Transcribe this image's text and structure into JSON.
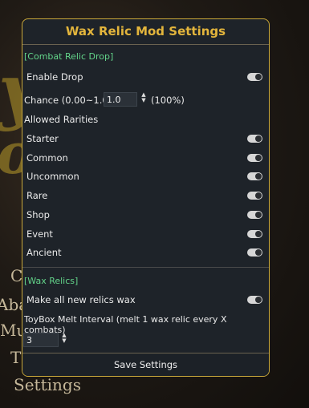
{
  "background": {
    "menu_items": [
      "C",
      "Aba",
      "Mu",
      "T",
      "Settings"
    ]
  },
  "panel": {
    "title": "Wax Relic Mod Settings",
    "combat_section": "[Combat Relic Drop]",
    "enable_drop_label": "Enable Drop",
    "chance_label": "Chance (0.00~1.00)",
    "chance_value": "1.0",
    "chance_percent": "(100%)",
    "allowed_rarities_label": "Allowed Rarities",
    "rarities": [
      {
        "label": "Starter",
        "enabled": true
      },
      {
        "label": "Common",
        "enabled": true
      },
      {
        "label": "Uncommon",
        "enabled": true
      },
      {
        "label": "Rare",
        "enabled": true
      },
      {
        "label": "Shop",
        "enabled": true
      },
      {
        "label": "Event",
        "enabled": true
      },
      {
        "label": "Ancient",
        "enabled": true
      }
    ],
    "wax_section": "[Wax Relics]",
    "make_wax_label": "Make all new relics wax",
    "make_wax_enabled": true,
    "melt_label": "ToyBox Melt Interval (melt 1 wax relic every X combats)",
    "melt_value": "3",
    "save_label": "Save Settings"
  },
  "colors": {
    "accent": "#e3b53c",
    "section": "#63d48a",
    "panel_bg": "#1e2329"
  }
}
